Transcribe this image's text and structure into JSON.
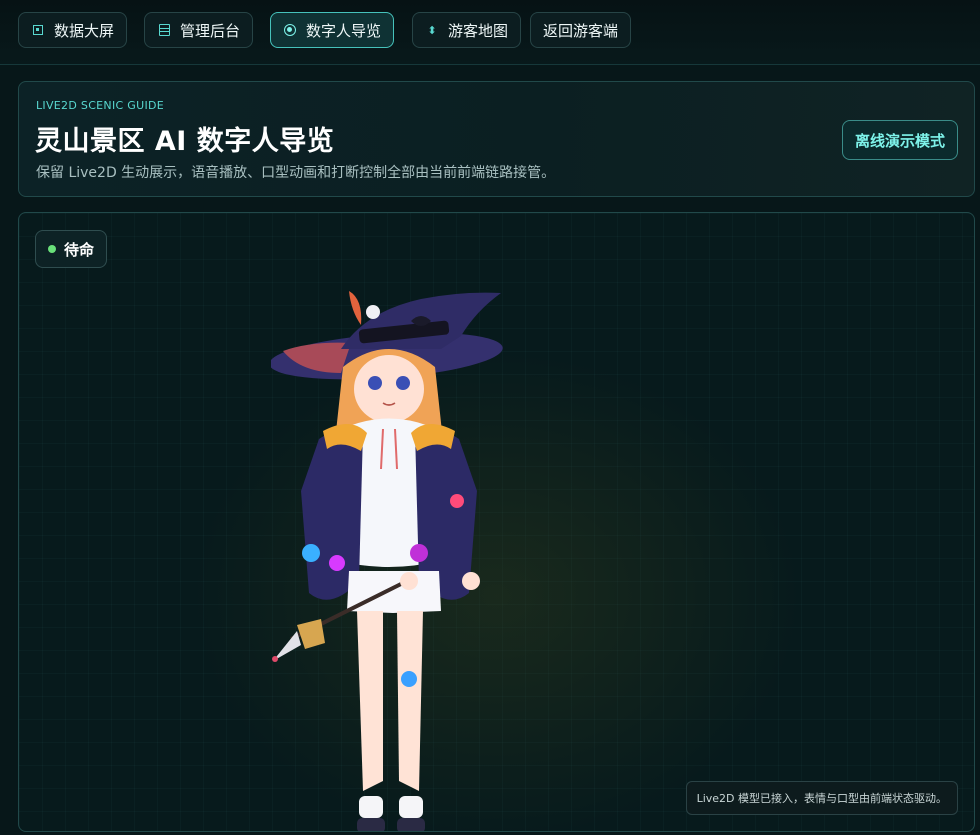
{
  "nav": {
    "items": [
      {
        "label": "数据大屏",
        "icon": "dashboard-square-icon",
        "active": false
      },
      {
        "label": "管理后台",
        "icon": "list-icon",
        "active": false
      },
      {
        "label": "数字人导览",
        "icon": "radio-target-icon",
        "active": true
      },
      {
        "label": "游客地图",
        "icon": "diamond-arrows-icon",
        "active": false
      },
      {
        "label": "返回游客端",
        "icon": "",
        "active": false
      }
    ]
  },
  "header": {
    "eyebrow": "LIVE2D SCENIC GUIDE",
    "title": "灵山景区 AI 数字人导览",
    "subtitle": "保留 Live2D 生动展示，语音播放、口型动画和打断控制全部由当前前端链路接管。",
    "mode_button": "离线演示模式"
  },
  "stage": {
    "status_label": "待命",
    "status_color": "#69e07a",
    "caption": "Live2D 模型已接入，表情与口型由前端状态驱动。"
  },
  "colors": {
    "accent": "#59d8d0",
    "background": "#071719"
  }
}
